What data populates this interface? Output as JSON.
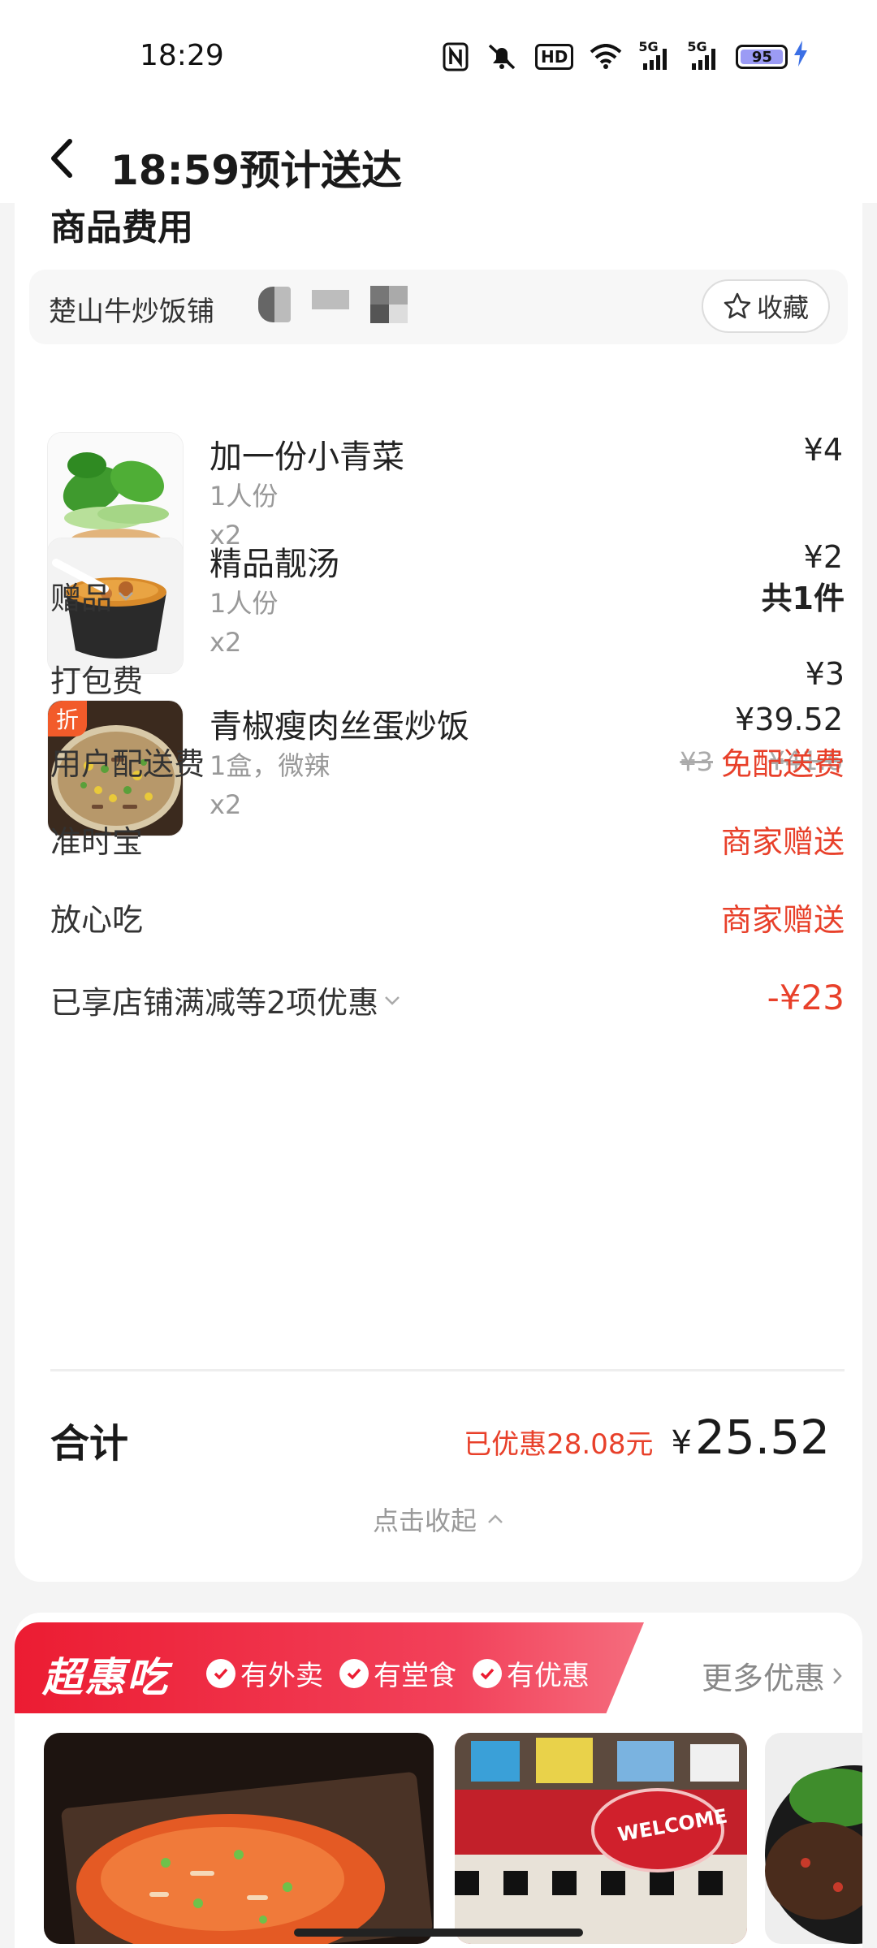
{
  "status_bar": {
    "time": "18:29",
    "icons": [
      "nfc-icon",
      "mute-icon",
      "hd-icon",
      "wifi-icon",
      "signal-5g-icon",
      "signal-5g-icon"
    ],
    "hd_label": "HD",
    "signal1_label": "5G",
    "signal2_label": "5G",
    "battery_level": "95"
  },
  "header": {
    "back_icon": "chevron-left-icon",
    "title": "18:59预计送达"
  },
  "section": {
    "title": "商品费用"
  },
  "shop": {
    "name": "楚山牛炒饭铺",
    "favorite_label": "收藏",
    "favorite_icon": "star-icon"
  },
  "items": [
    {
      "name": "加一份小青菜",
      "spec": "1人份",
      "qty": "x2",
      "price": "¥4",
      "original_price": ""
    },
    {
      "name": "精品靓汤",
      "spec": "1人份",
      "qty": "x2",
      "price": "¥2",
      "original_price": ""
    },
    {
      "name": "青椒瘦肉丝蛋炒饭",
      "spec": "1盒，微辣",
      "qty": "x2",
      "price": "¥39.52",
      "original_price": "¥41.6",
      "tag": "折"
    }
  ],
  "fees": {
    "gift_label": "赠品",
    "gift_value": "共1件",
    "packing_label": "打包费",
    "packing_value": "¥3",
    "delivery_label": "用户配送费",
    "delivery_orig": "¥3",
    "delivery_value": "免配送费",
    "ontime_label": "准时宝",
    "ontime_value": "商家赠送",
    "safe_label": "放心吃",
    "safe_value": "商家赠送",
    "discount_label": "已享店铺满减等2项优惠",
    "discount_value": "-¥23"
  },
  "total": {
    "label": "合计",
    "saved": "已优惠28.08元",
    "currency": "¥",
    "amount": "25.52"
  },
  "collapse_label": "点击收起",
  "promo": {
    "brand": "超惠吃",
    "tags": [
      "有外卖",
      "有堂食",
      "有优惠"
    ],
    "more_label": "更多优惠",
    "tile_captions": [
      "WELCOME"
    ]
  },
  "colors": {
    "accent_red": "#e8402a",
    "promo_red": "#ec1c32",
    "battery_fill": "#9b9bf5",
    "charge_blue": "#3b6fe5"
  }
}
